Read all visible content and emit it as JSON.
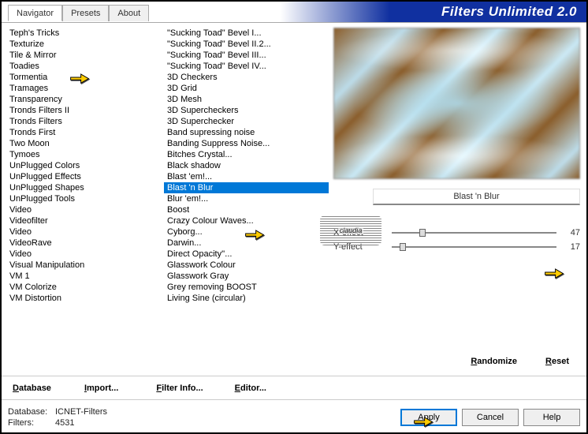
{
  "title": "Filters Unlimited 2.0",
  "tabs": [
    "Navigator",
    "Presets",
    "About"
  ],
  "activeTab": 0,
  "categories": [
    "Teph's Tricks",
    "Texturize",
    "Tile & Mirror",
    "Toadies",
    "Tormentia",
    "Tramages",
    "Transparency",
    "Tronds Filters II",
    "Tronds Filters",
    "Tronds First",
    "Two Moon",
    "Tymoes",
    "UnPlugged Colors",
    "UnPlugged Effects",
    "UnPlugged Shapes",
    "UnPlugged Tools",
    "Video",
    "Videofilter",
    "Video",
    "VideoRave",
    "Video",
    "Visual Manipulation",
    "VM 1",
    "VM Colorize",
    "VM Distortion"
  ],
  "categorySelectedIndex": 3,
  "filters": [
    "\"Sucking Toad\"  Bevel I...",
    "\"Sucking Toad\"  Bevel II.2...",
    "\"Sucking Toad\"  Bevel III...",
    "\"Sucking Toad\"  Bevel IV...",
    "3D Checkers",
    "3D Grid",
    "3D Mesh",
    "3D Supercheckers",
    "3D Superchecker",
    "Band supressing noise",
    "Banding Suppress Noise...",
    "Bitches Crystal...",
    "Black shadow",
    "Blast 'em!...",
    "Blast 'n Blur",
    "Blur 'em!...",
    "Boost",
    "Crazy Colour Waves...",
    "Cyborg...",
    "Darwin...",
    "Direct Opacity''...",
    "Glasswork Colour",
    "Glasswork Gray",
    "Grey removing BOOST",
    "Living Sine (circular)"
  ],
  "filterSelectedIndex": 14,
  "selectedFilterName": "Blast 'n Blur",
  "params": {
    "x": {
      "label": "X-effect",
      "value": 47,
      "max": 255
    },
    "y": {
      "label": "Y-effect",
      "value": 17,
      "max": 255
    }
  },
  "buttons": {
    "database": "Database",
    "import": "Import...",
    "filterInfo": "Filter Info...",
    "editor": "Editor...",
    "randomize": "Randomize",
    "reset": "Reset",
    "apply": "Apply",
    "cancel": "Cancel",
    "help": "Help"
  },
  "status": {
    "dbLabel": "Database:",
    "dbValue": "ICNET-Filters",
    "filtersLabel": "Filters:",
    "filtersValue": "4531"
  },
  "watermark": "claudia"
}
